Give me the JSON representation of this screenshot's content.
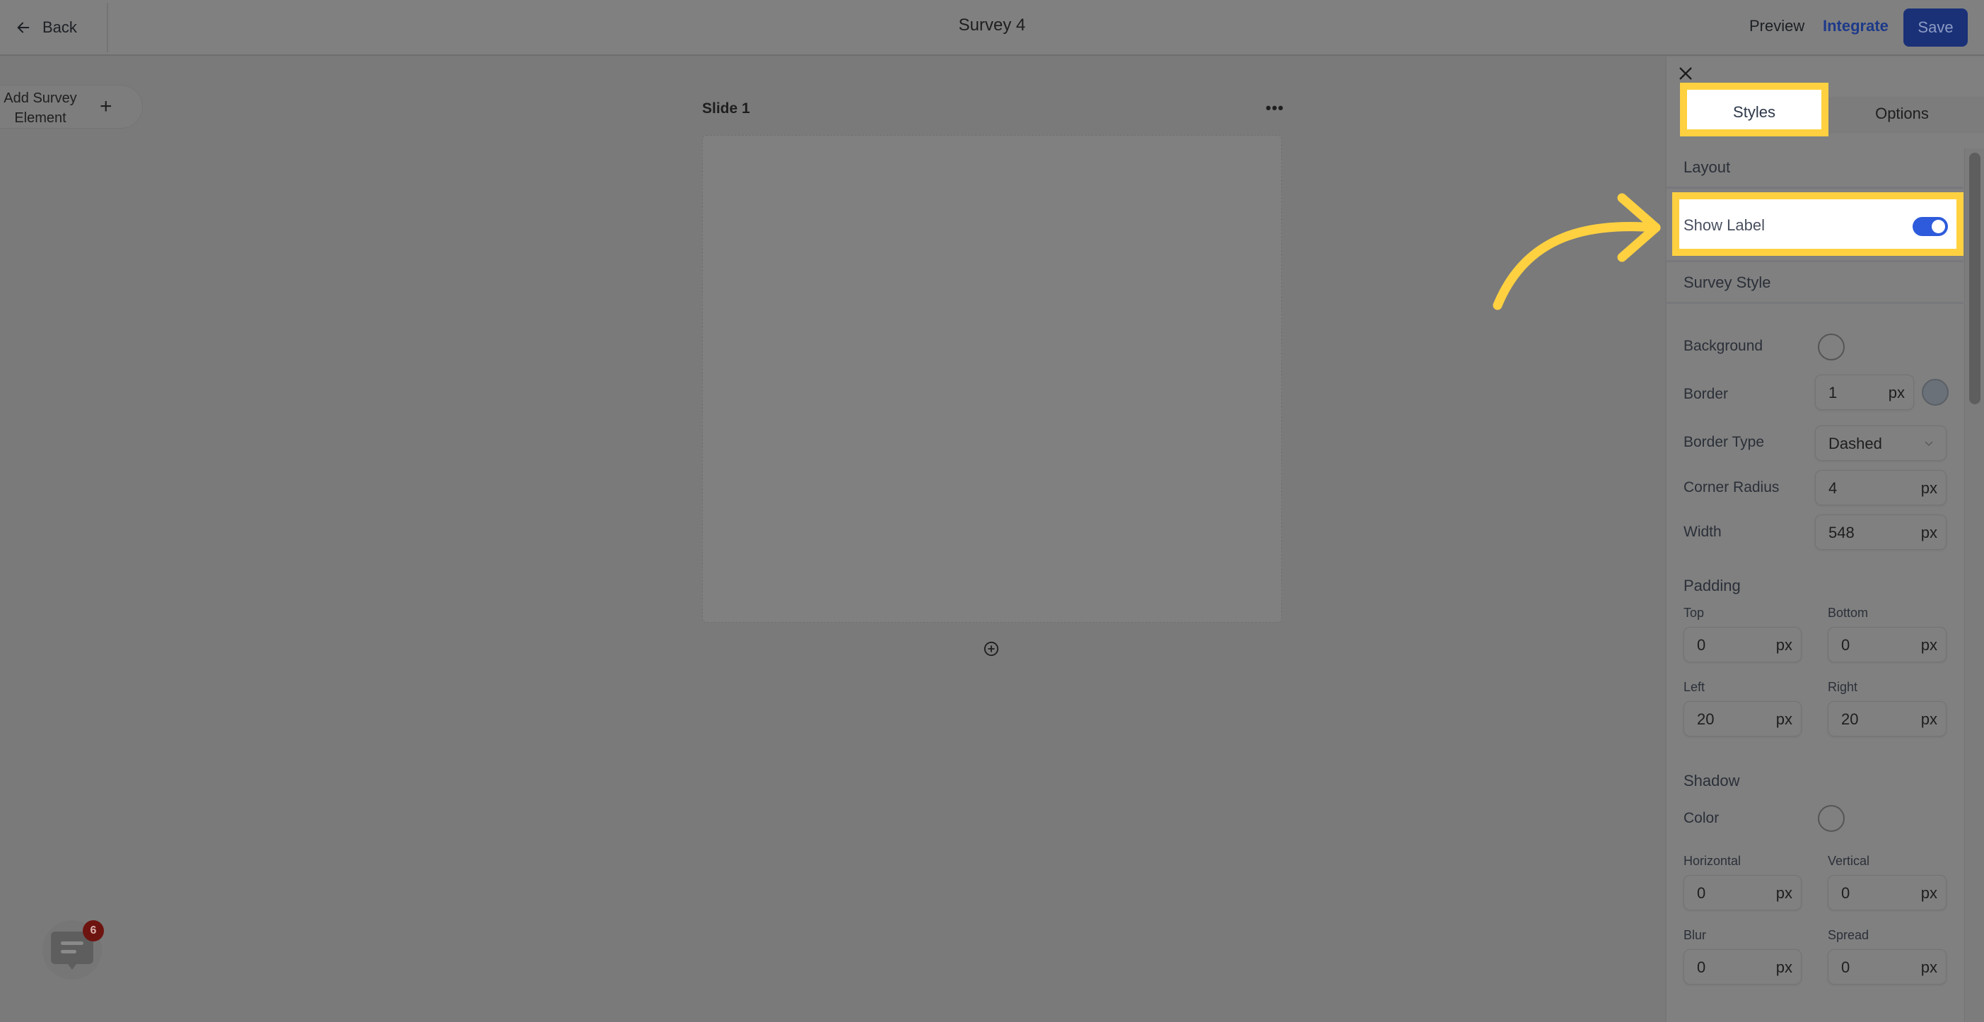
{
  "header": {
    "back_label": "Back",
    "title": "Survey 4",
    "preview_label": "Preview",
    "integrate_label": "Integrate",
    "save_label": "Save"
  },
  "sidebar": {
    "add_element_label": "Add Survey Element",
    "add_icon": "plus-icon"
  },
  "canvas": {
    "slide_label": "Slide 1",
    "menu_icon": "more-horizontal-icon",
    "add_slide_icon": "plus-circle-icon"
  },
  "panel": {
    "close_icon": "close-icon",
    "tabs": [
      {
        "label": "Styles",
        "active": true
      },
      {
        "label": "Options",
        "active": false
      }
    ],
    "layout": {
      "title": "Layout",
      "show_label": {
        "label": "Show Label",
        "enabled": true
      }
    },
    "survey_style": {
      "title": "Survey Style",
      "background": {
        "label": "Background",
        "color": "transparent"
      },
      "border": {
        "label": "Border",
        "value": "1",
        "unit": "px",
        "color": "#6b7178"
      },
      "border_type": {
        "label": "Border Type",
        "value": "Dashed"
      },
      "corner_radius": {
        "label": "Corner Radius",
        "value": "4",
        "unit": "px"
      },
      "width": {
        "label": "Width",
        "value": "548",
        "unit": "px"
      }
    },
    "padding": {
      "title": "Padding",
      "top": {
        "label": "Top",
        "value": "0",
        "unit": "px"
      },
      "bottom": {
        "label": "Bottom",
        "value": "0",
        "unit": "px"
      },
      "left": {
        "label": "Left",
        "value": "20",
        "unit": "px"
      },
      "right": {
        "label": "Right",
        "value": "20",
        "unit": "px"
      }
    },
    "shadow": {
      "title": "Shadow",
      "color": {
        "label": "Color",
        "color": "transparent"
      },
      "horizontal": {
        "label": "Horizontal",
        "value": "0",
        "unit": "px"
      },
      "vertical": {
        "label": "Vertical",
        "value": "0",
        "unit": "px"
      },
      "blur": {
        "label": "Blur",
        "value": "0",
        "unit": "px"
      },
      "spread": {
        "label": "Spread",
        "value": "0",
        "unit": "px"
      }
    }
  },
  "chat_widget": {
    "icon": "chat-icon",
    "badge_count": "6"
  },
  "annotation": {
    "highlight_color": "#ffd140",
    "arrow_target": "Show Label"
  },
  "colors": {
    "accent": "#2e5bdb",
    "save_button": "#1a3178",
    "integrate_link": "#1d3a8a",
    "badge": "#6e1410"
  }
}
